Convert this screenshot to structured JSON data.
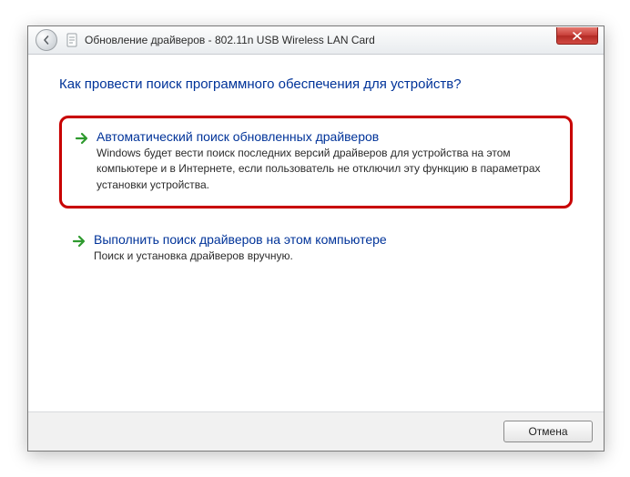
{
  "titlebar": {
    "text": "Обновление драйверов - 802.11n USB Wireless LAN Card"
  },
  "heading": "Как провести поиск программного обеспечения для устройств?",
  "options": {
    "auto": {
      "title": "Автоматический поиск обновленных драйверов",
      "desc": "Windows будет вести поиск последних версий драйверов для устройства на этом компьютере и в Интернете, если пользователь не отключил эту функцию в параметрах установки устройства."
    },
    "manual": {
      "title": "Выполнить поиск драйверов на этом компьютере",
      "desc": "Поиск и установка драйверов вручную."
    }
  },
  "footer": {
    "cancel": "Отмена"
  }
}
